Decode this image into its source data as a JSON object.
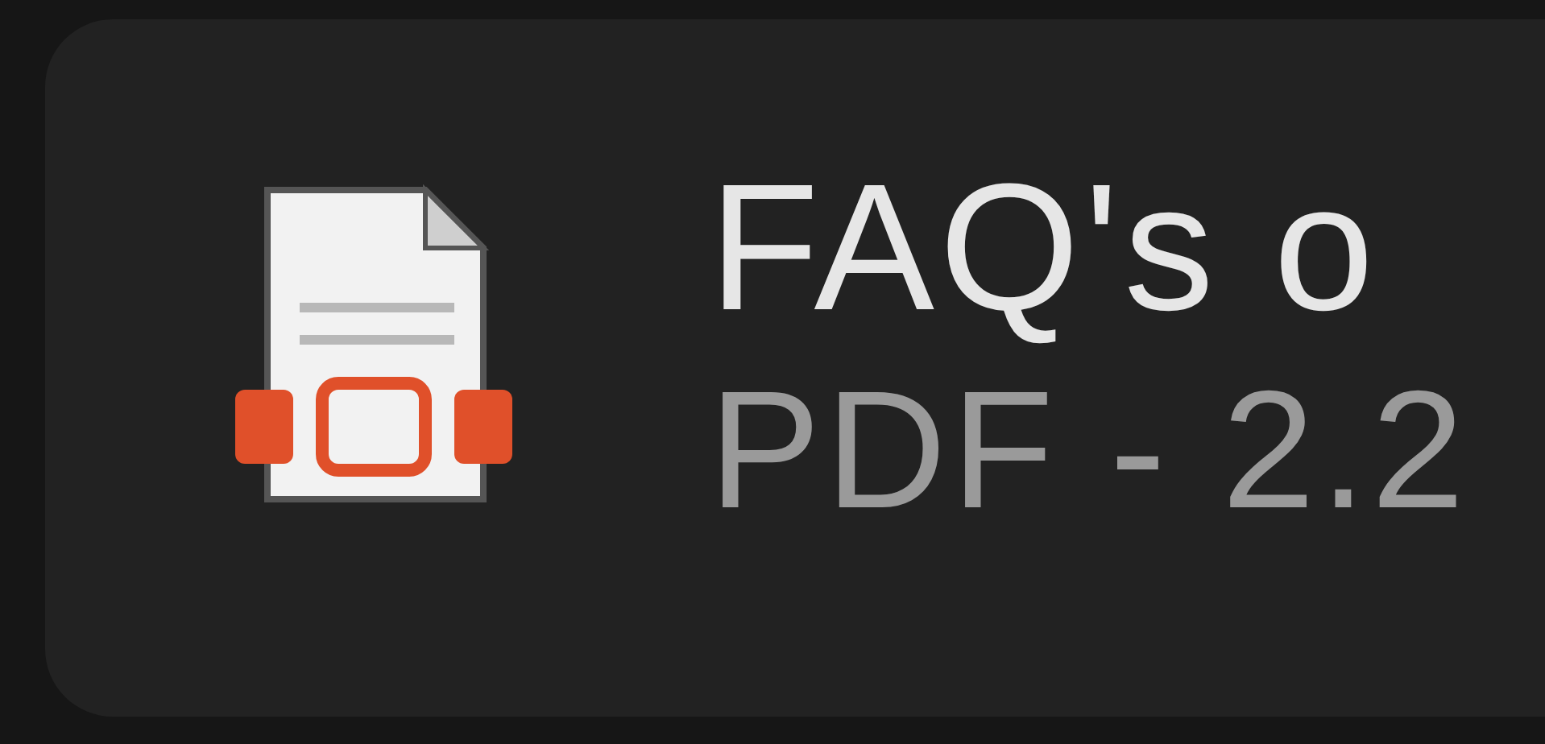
{
  "attachment": {
    "title": "FAQ's o",
    "meta": "PDF - 2.2"
  }
}
